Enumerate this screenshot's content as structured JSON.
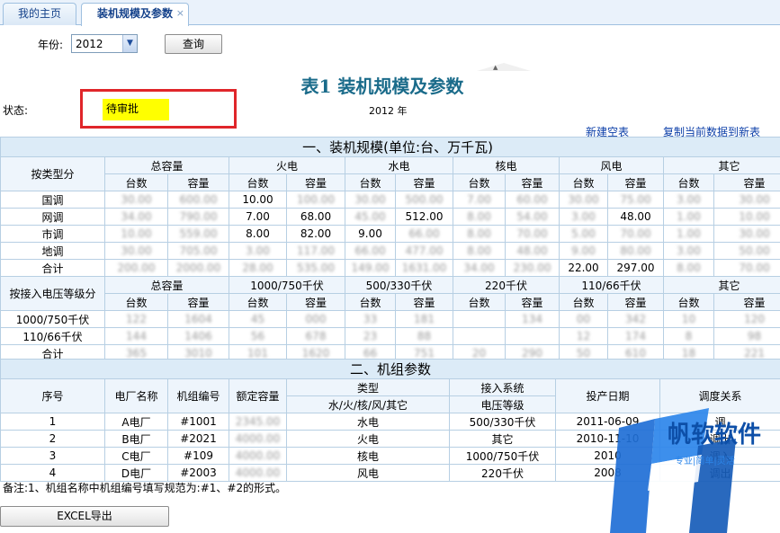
{
  "tabs": [
    {
      "label": "我的主页"
    },
    {
      "label": "装机规模及参数",
      "close": "×"
    }
  ],
  "search": {
    "year_label": "年份:",
    "year_value": "2012",
    "query_label": "查询"
  },
  "title": "表1  装机规模及参数",
  "status": {
    "label": "状态:",
    "value": "待审批",
    "year_text": "2012 年"
  },
  "links": {
    "new_table": "新建空表",
    "copy_data": "复制当前数据到新表"
  },
  "section1": {
    "title": "一、装机规模(单位:台、万千瓦)",
    "by_type_label": "按类型分",
    "groups": [
      "总容量",
      "火电",
      "水电",
      "核电",
      "风电",
      "其它"
    ],
    "sub": [
      "台数",
      "容量"
    ],
    "rows": [
      {
        "name": "国调",
        "cells": [
          "30.00",
          "600.00",
          "10.00",
          "100.00",
          "30.00",
          "500.00",
          "7.00",
          "60.00",
          "30.00",
          "75.00",
          "3.00",
          "30.00"
        ]
      },
      {
        "name": "网调",
        "cells": [
          "34.00",
          "790.00",
          "7.00",
          "68.00",
          "45.00",
          "512.00",
          "8.00",
          "54.00",
          "3.00",
          "48.00",
          "1.00",
          "10.00"
        ]
      },
      {
        "name": "市调",
        "cells": [
          "10.00",
          "559.00",
          "8.00",
          "82.00",
          "9.00",
          "66.00",
          "8.00",
          "70.00",
          "5.00",
          "70.00",
          "1.00",
          "30.00"
        ]
      },
      {
        "name": "地调",
        "cells": [
          "30.00",
          "705.00",
          "3.00",
          "117.00",
          "66.00",
          "477.00",
          "8.00",
          "48.00",
          "9.00",
          "80.00",
          "3.00",
          "50.00"
        ]
      },
      {
        "name": "合计",
        "cells": [
          "200.00",
          "2000.00",
          "28.00",
          "535.00",
          "149.00",
          "1631.00",
          "34.00",
          "230.00",
          "22.00",
          "297.00",
          "8.00",
          "70.00"
        ]
      }
    ],
    "blurred_cells": [
      [
        true,
        true,
        false,
        true,
        true,
        true,
        true,
        true,
        true,
        true,
        true,
        true
      ],
      [
        true,
        true,
        false,
        false,
        true,
        false,
        true,
        true,
        true,
        false,
        true,
        true
      ],
      [
        true,
        true,
        false,
        false,
        false,
        true,
        true,
        true,
        true,
        true,
        true,
        true
      ],
      [
        true,
        true,
        true,
        true,
        true,
        true,
        true,
        true,
        true,
        true,
        true,
        true
      ],
      [
        true,
        true,
        true,
        true,
        true,
        true,
        true,
        true,
        false,
        false,
        true,
        true
      ]
    ],
    "by_voltage_label": "按接入电压等级分",
    "voltage_groups": [
      "总容量",
      "1000/750千伏",
      "500/330千伏",
      "220千伏",
      "110/66千伏",
      "其它"
    ],
    "voltage_rows": [
      {
        "name": "1000/750千伏",
        "cells": [
          "122",
          "1604",
          "45",
          "000",
          "33",
          "181",
          "",
          "134",
          "00",
          "342",
          "10",
          "120"
        ]
      },
      {
        "name": "110/66千伏",
        "cells": [
          "144",
          "1406",
          "56",
          "678",
          "23",
          "88",
          "",
          "",
          "12",
          "174",
          "8",
          "98"
        ]
      },
      {
        "name": "合计",
        "cells": [
          "365",
          "3010",
          "101",
          "1620",
          "66",
          "751",
          "20",
          "290",
          "50",
          "610",
          "18",
          "221"
        ]
      }
    ],
    "voltage_blurred": [
      [
        true,
        true,
        true,
        true,
        true,
        true,
        false,
        true,
        true,
        true,
        true,
        true
      ],
      [
        true,
        true,
        true,
        true,
        true,
        true,
        false,
        false,
        true,
        true,
        true,
        true
      ],
      [
        true,
        true,
        true,
        true,
        true,
        true,
        true,
        true,
        true,
        true,
        true,
        true
      ]
    ]
  },
  "section2": {
    "title": "二、机组参数",
    "headers": {
      "seq": "序号",
      "plant": "电厂名称",
      "unit": "机组编号",
      "capacity": "额定容量",
      "type": "类型",
      "type_sub": "水/火/核/风/其它",
      "access": "接入系统",
      "access_sub": "电压等级",
      "date": "投产日期",
      "relation": "调度关系"
    },
    "rows": [
      {
        "seq": "1",
        "plant": "A电厂",
        "unit": "#1001",
        "capacity": "2345.00",
        "type": "水电",
        "voltage": "500/330千伏",
        "date": "2011-06-09",
        "relation": "调"
      },
      {
        "seq": "2",
        "plant": "B电厂",
        "unit": "#2021",
        "capacity": "4000.00",
        "type": "火电",
        "voltage": "其它",
        "date": "2010-11-10",
        "relation": "调出"
      },
      {
        "seq": "3",
        "plant": "C电厂",
        "unit": "#109",
        "capacity": "4000.00",
        "type": "核电",
        "voltage": "1000/750千伏",
        "date": "2010",
        "relation": "调入"
      },
      {
        "seq": "4",
        "plant": "D电厂",
        "unit": "#2003",
        "capacity": "4000.00",
        "type": "风电",
        "voltage": "220千伏",
        "date": "2008",
        "relation": "调出"
      }
    ]
  },
  "note": "备注:1、机组名称中机组编号填写规范为:#1、#2的形式。",
  "excel_label": "EXCEL导出",
  "watermark": {
    "brand": "帆软软件",
    "slogan": "专业·简单·灵活"
  }
}
